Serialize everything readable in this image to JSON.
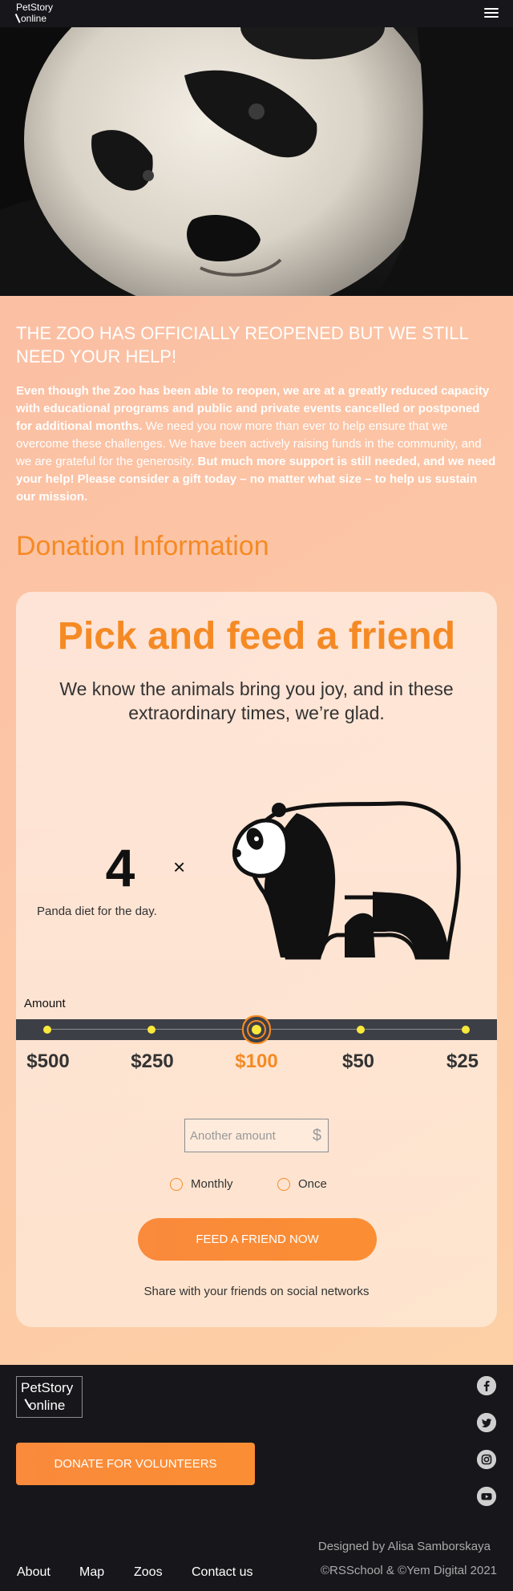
{
  "header": {
    "logo_line1": "PetStory",
    "logo_line2": "online",
    "menu_icon": "burger-menu-icon"
  },
  "hero": {
    "image": "panda-closeup-photo"
  },
  "intro": {
    "title": "THE ZOO HAS OFFICIALLY REOPENED BUT WE STILL NEED YOUR HELP!",
    "text_bold_1": "Even though the Zoo has been able to reopen, we are at a greatly reduced capacity with educational programs and public and private events cancelled or postponed for additional months.",
    "text_regular": " We need you now more than ever to help ensure that we overcome these challenges. We have been actively raising funds in the community, and we are grateful for the generosity. ",
    "text_bold_2": "But much more support is still needed, and we need your help! Please consider a gift today – no matter what size – to help us sustain our mission."
  },
  "donation": {
    "heading": "Donation Information",
    "card_title": "Pick and feed a friend",
    "card_subtitle": "We know the animals bring you joy, and in these extraordinary times, we’re glad.",
    "count": "4",
    "times_symbol": "×",
    "diet_label": "Panda diet for the day.",
    "animal_icon": "panda-icon",
    "amount_label": "Amount",
    "amounts": [
      "$500",
      "$250",
      "$100",
      "$50",
      "$25"
    ],
    "selected_amount": "$100",
    "input_placeholder": "Another amount",
    "currency_symbol": "$",
    "frequency_options": [
      "Monthly",
      "Once"
    ],
    "feed_button": "FEED A FRIEND NOW",
    "share_text": "Share with your friends on social networks",
    "accent_color": "#f58a25"
  },
  "footer": {
    "logo_line1": "PetStory",
    "logo_line2": "online",
    "donate_button": "DONATE FOR VOLUNTEERS",
    "social_icons": [
      "facebook-icon",
      "twitter-icon",
      "instagram-icon",
      "youtube-icon"
    ],
    "designed_by": "Designed by Alisa Samborskaya",
    "copyright": "©RSSchool & ©Yem Digital 2021",
    "nav": [
      "About",
      "Map",
      "Zoos",
      "Contact us"
    ]
  }
}
